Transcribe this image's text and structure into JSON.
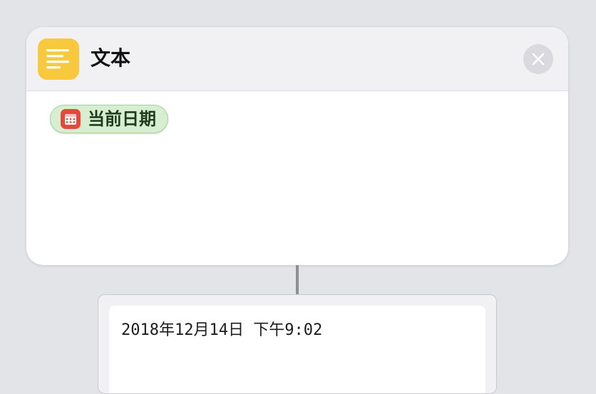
{
  "action": {
    "title": "文本",
    "icon": "text-lines-icon",
    "icon_color": "#f8c93c",
    "close_icon": "close-icon"
  },
  "variable": {
    "label": "当前日期",
    "icon": "calendar-icon",
    "icon_color": "#e5493a",
    "token_color": "#d7efd0"
  },
  "result": {
    "text": "2018年12月14日 下午9:02"
  }
}
